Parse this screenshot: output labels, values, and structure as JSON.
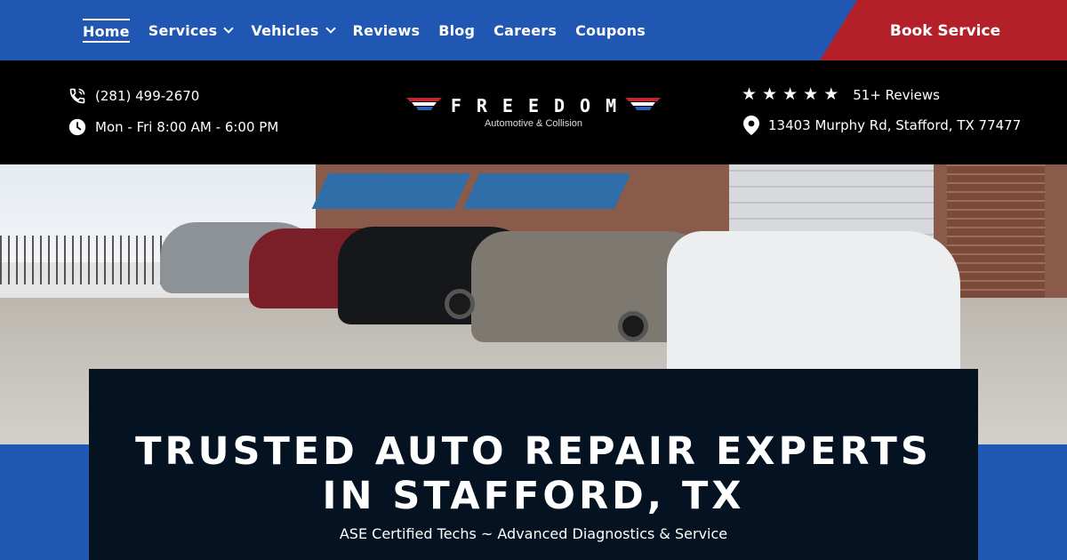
{
  "nav": {
    "items": [
      {
        "label": "Home",
        "active": true,
        "dropdown": false
      },
      {
        "label": "Services",
        "active": false,
        "dropdown": true
      },
      {
        "label": "Vehicles",
        "active": false,
        "dropdown": true
      },
      {
        "label": "Reviews",
        "active": false,
        "dropdown": false
      },
      {
        "label": "Blog",
        "active": false,
        "dropdown": false
      },
      {
        "label": "Careers",
        "active": false,
        "dropdown": false
      },
      {
        "label": "Coupons",
        "active": false,
        "dropdown": false
      }
    ],
    "book_label": "Book Service"
  },
  "info": {
    "phone": "(281) 499-2670",
    "hours": "Mon - Fri 8:00 AM - 6:00 PM",
    "rating_stars": 5,
    "reviews": "51+ Reviews",
    "address": "13403 Murphy Rd, Stafford, TX 77477"
  },
  "logo": {
    "word": "FREEDOM",
    "sub": "Automotive & Collision"
  },
  "hero": {
    "headline_line1": "TRUSTED AUTO REPAIR EXPERTS",
    "headline_line2": "IN STAFFORD, TX",
    "tagline": "ASE Certified Techs ~ Advanced Diagnostics & Service"
  },
  "colors": {
    "brand_blue": "#1f57b3",
    "brand_red": "#b3202a",
    "panel_navy": "#041221"
  },
  "icons": {
    "phone": "phone-icon",
    "clock": "clock-icon",
    "star": "star-icon",
    "pin": "map-pin-icon",
    "chevron": "chevron-down-icon"
  }
}
